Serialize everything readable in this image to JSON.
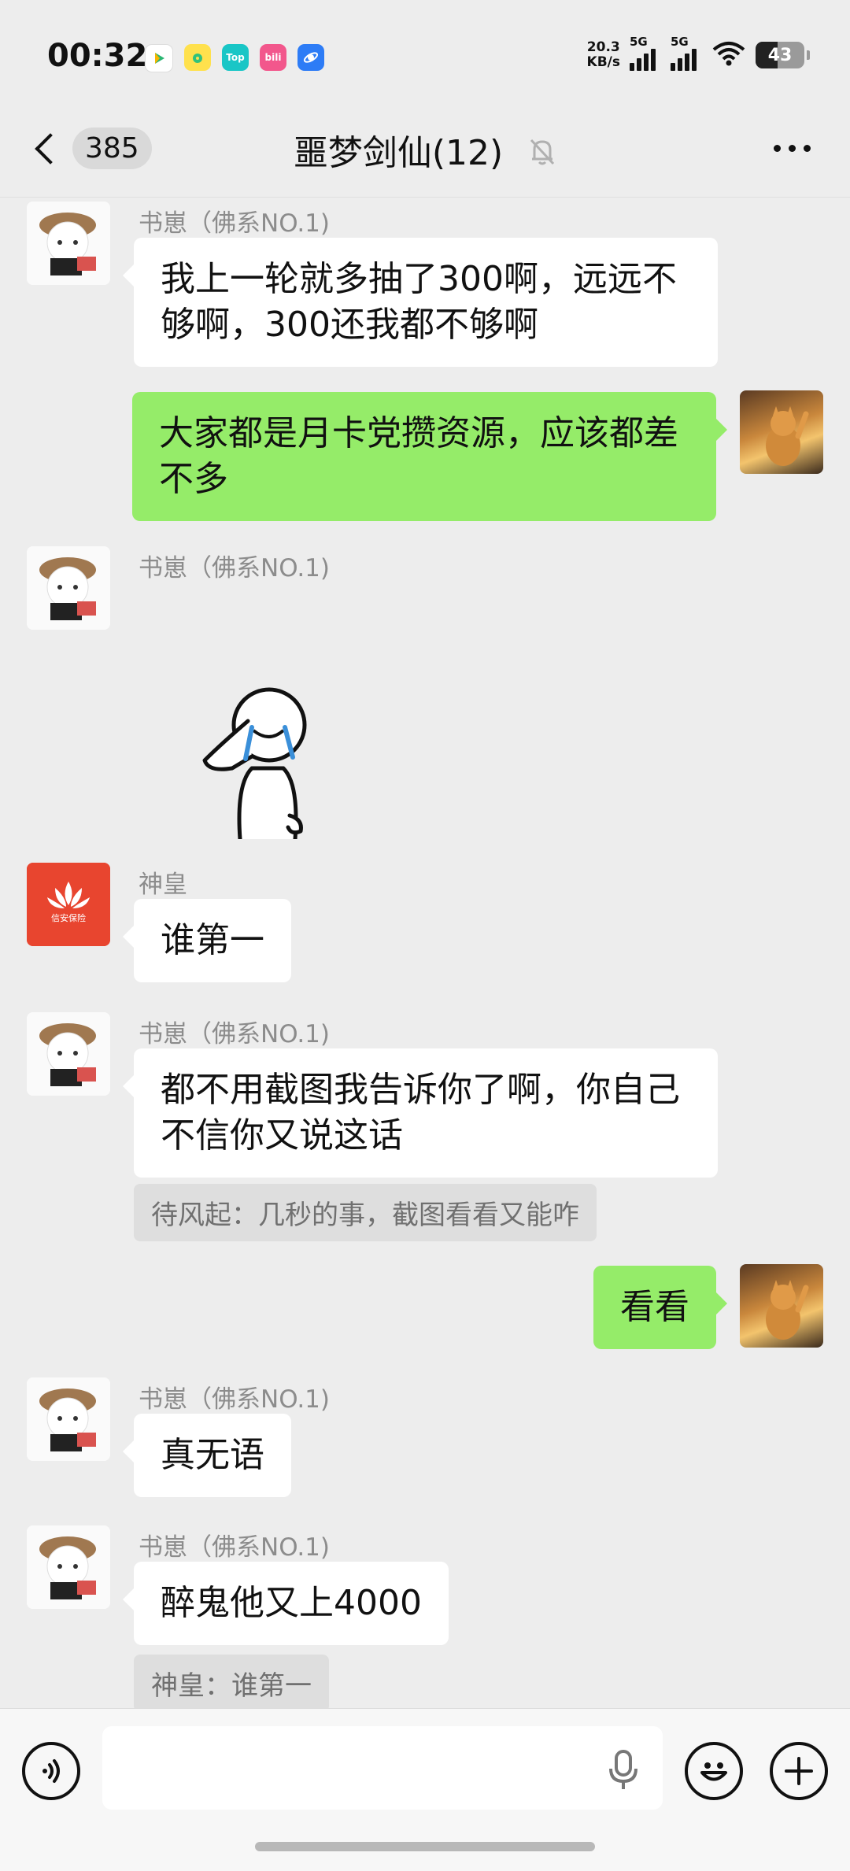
{
  "status_bar": {
    "time": "00:32",
    "net_speed_value": "20.3",
    "net_speed_unit": "KB/s",
    "signal1_label": "5G",
    "signal2_label": "5G",
    "battery": "43",
    "app_icons": [
      "video-icon",
      "music-icon",
      "top-app-icon",
      "bilibili-icon",
      "browser-icon"
    ],
    "top_icon_text": "Top",
    "bili_icon_text": "bili"
  },
  "header": {
    "back_count": "385",
    "title": "噩梦剑仙(12)",
    "mute_icon": "bell-muted-icon",
    "more_icon": "more-icon"
  },
  "messages": [
    {
      "sender": "书崽（佛系NO.1)",
      "text_line1": "我上一轮就多抽了300啊，远远不",
      "text_line2": "够啊，300还我都不够啊"
    },
    {
      "text_line1": "大家都是月卡党攒资源，应该都差",
      "text_line2": "不多"
    },
    {
      "sender": "书崽（佛系NO.1)",
      "sticker": "saluting-crying-sticker"
    },
    {
      "sender": "神皇",
      "text": "谁第一",
      "avatar_text": "信安保险"
    },
    {
      "sender": "书崽（佛系NO.1)",
      "text_line1": "都不用截图我告诉你了啊，你自己",
      "text_line2": "不信你又说这话",
      "quote": "待风起：几秒的事，截图看看又能咋"
    },
    {
      "text": "看看"
    },
    {
      "sender": "书崽（佛系NO.1)",
      "text": "真无语"
    },
    {
      "sender": "书崽（佛系NO.1)",
      "text": "醉鬼他又上4000",
      "quote": "神皇：谁第一"
    }
  ],
  "input_bar": {
    "placeholder": "",
    "voice_icon": "voice-mode-icon",
    "mic_icon": "microphone-icon",
    "emoji_icon": "emoji-icon",
    "plus_icon": "plus-icon"
  },
  "colors": {
    "background": "#ededed",
    "outgoing_bubble": "#95ec69",
    "incoming_bubble": "#ffffff"
  }
}
